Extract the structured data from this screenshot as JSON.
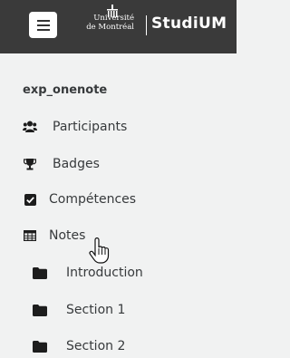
{
  "header": {
    "logo_line1": "Université",
    "logo_line2": "de Montréal",
    "brand": "StudiUM",
    "menu_icon": "hamburger-icon",
    "background": "#3a3a3a"
  },
  "course": {
    "title": "exp_onenote"
  },
  "nav": {
    "participants": "Participants",
    "badges": "Badges",
    "competences": "Compétences",
    "notes": "Notes"
  },
  "sections": {
    "introduction": "Introduction",
    "section1": "Section 1",
    "section2": "Section 2"
  }
}
